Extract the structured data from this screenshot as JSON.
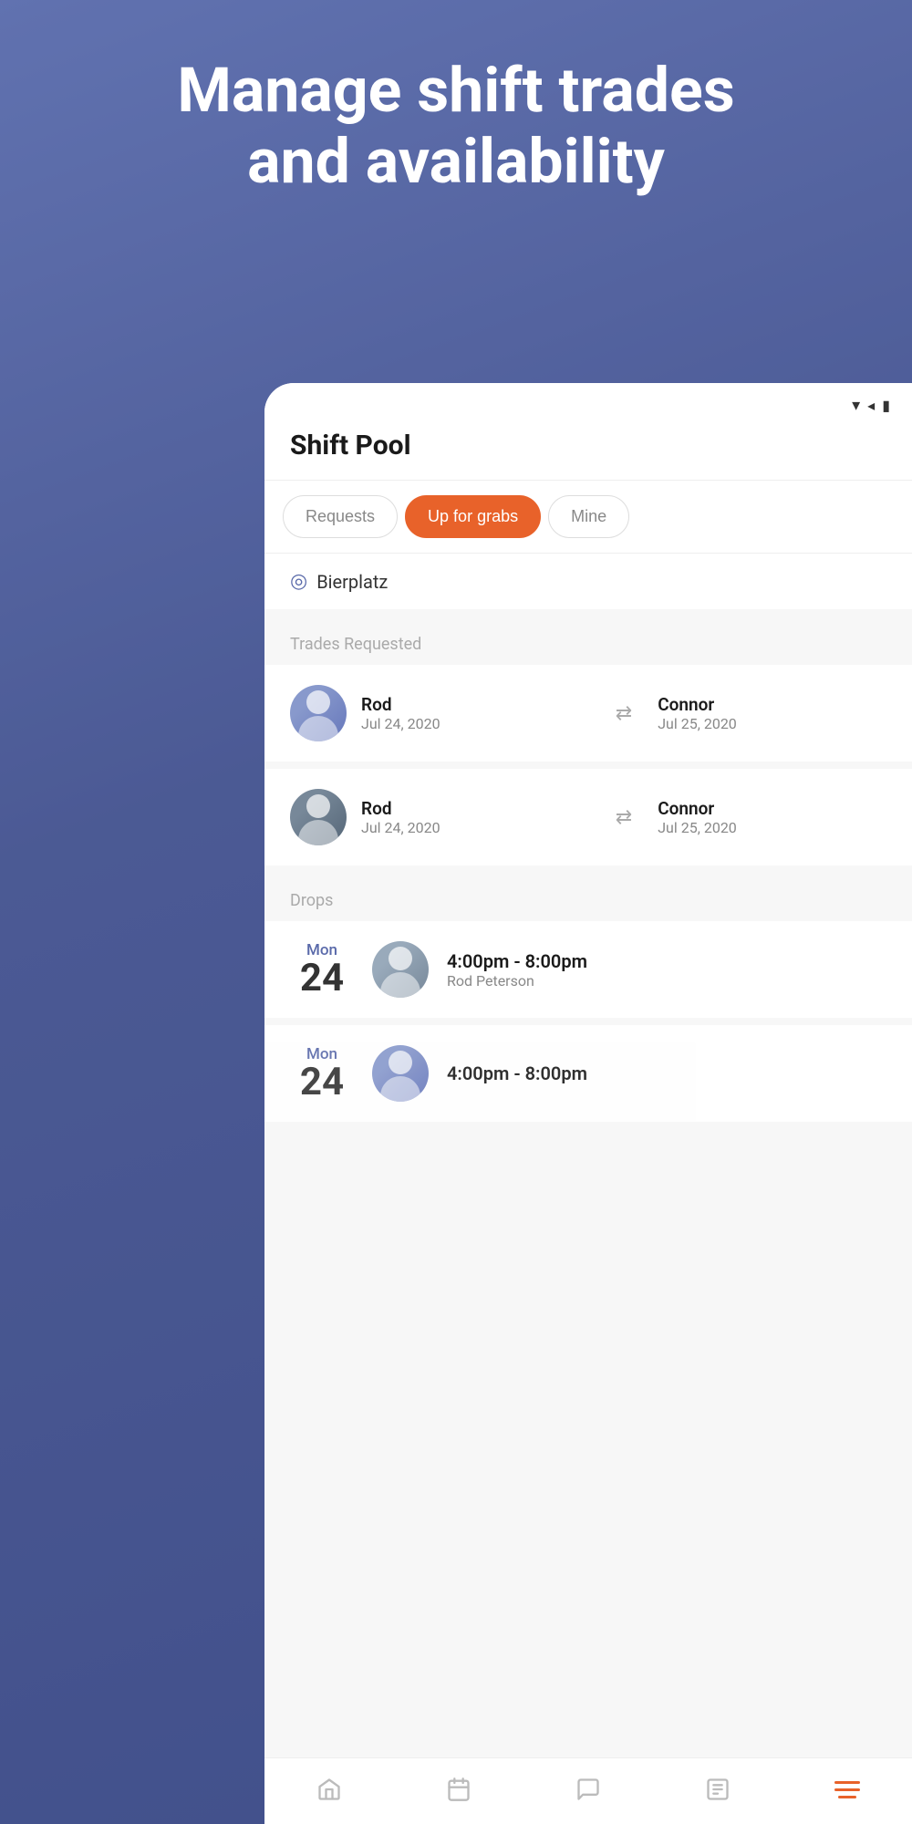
{
  "hero": {
    "title_line1": "Manage shift trades",
    "title_line2": "and availability"
  },
  "statusbar": {
    "wifi": "▼",
    "signal": "◀",
    "battery": "▮"
  },
  "header": {
    "title": "Shift Pool"
  },
  "tabs": [
    {
      "label": "Requests",
      "active": false
    },
    {
      "label": "Up for grabs",
      "active": true
    },
    {
      "label": "Mine",
      "active": false
    }
  ],
  "location": {
    "name": "Bierplatz"
  },
  "trades_section": {
    "label": "Trades Requested",
    "items": [
      {
        "from_name": "Rod",
        "from_date": "Jul 24, 2020",
        "to_name": "Connor",
        "to_date": "Jul 25, 2020"
      },
      {
        "from_name": "Rod",
        "from_date": "Jul 24, 2020",
        "to_name": "Connor",
        "to_date": "Jul 25, 2020"
      }
    ]
  },
  "drops_section": {
    "label": "Drops",
    "items": [
      {
        "day_name": "Mon",
        "day_num": "24",
        "time": "4:00pm - 8:00pm",
        "person": "Rod Peterson"
      },
      {
        "day_name": "Mon",
        "day_num": "24",
        "time": "4:00pm - 8:00pm",
        "person": ""
      }
    ]
  },
  "bottom_nav": {
    "items": [
      {
        "label": "home",
        "icon": "home",
        "active": false
      },
      {
        "label": "calendar",
        "icon": "calendar",
        "active": false
      },
      {
        "label": "chat",
        "icon": "chat",
        "active": false
      },
      {
        "label": "tasks",
        "icon": "tasks",
        "active": false
      },
      {
        "label": "menu",
        "icon": "menu",
        "active": true
      }
    ]
  }
}
